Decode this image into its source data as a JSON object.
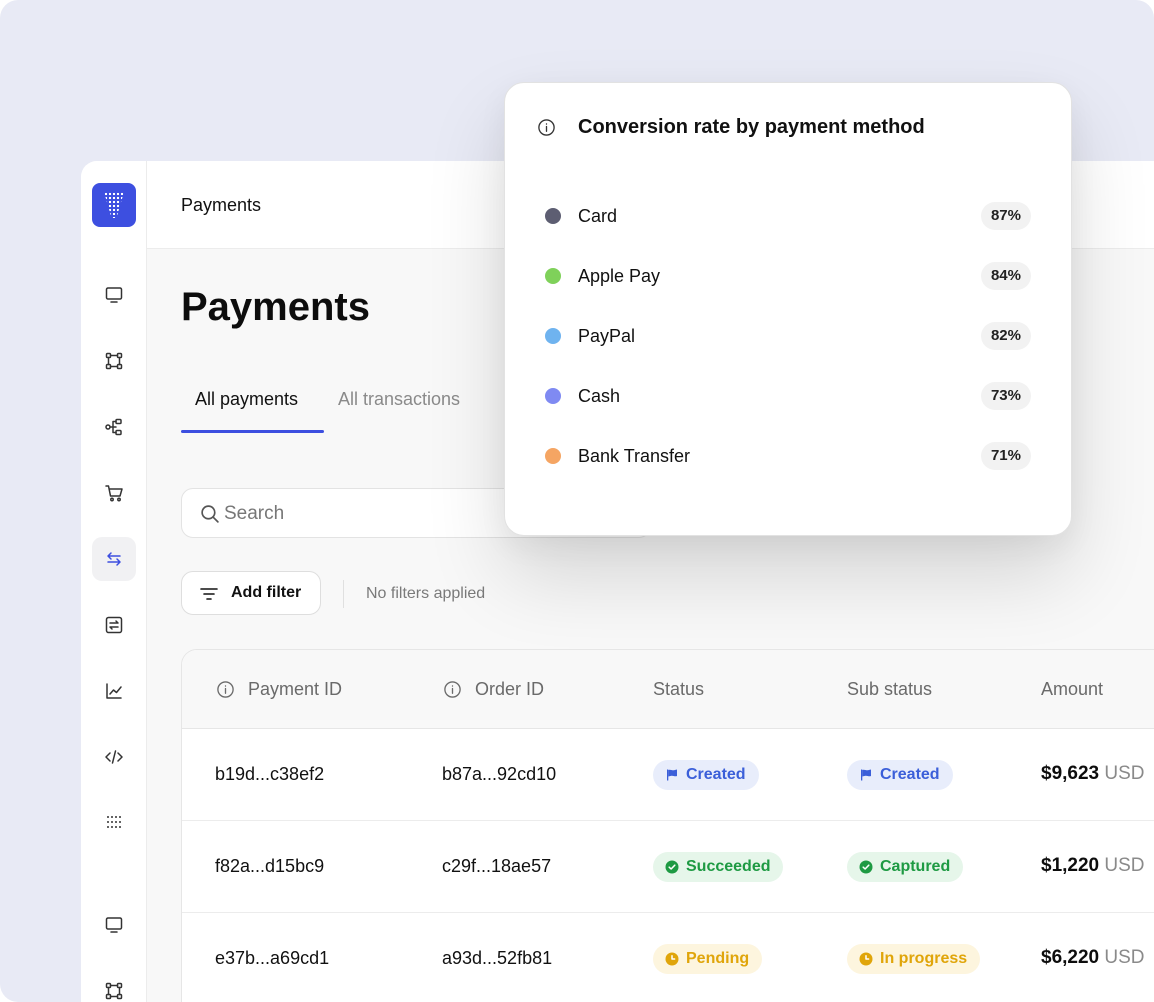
{
  "topbar": {
    "breadcrumb": "Payments"
  },
  "page": {
    "title": "Payments"
  },
  "tabs": [
    {
      "label": "All payments",
      "active": true
    },
    {
      "label": "All transactions",
      "active": false
    }
  ],
  "search": {
    "placeholder": "Search"
  },
  "filters": {
    "add_label": "Add filter",
    "status": "No filters applied"
  },
  "sidebar": {
    "items": [
      {
        "icon": "monitor-icon"
      },
      {
        "icon": "nodes-icon"
      },
      {
        "icon": "workflow-icon"
      },
      {
        "icon": "cart-icon"
      },
      {
        "icon": "transfer-arrows-icon",
        "active": true
      },
      {
        "icon": "exchange-icon"
      },
      {
        "icon": "chart-line-icon"
      },
      {
        "icon": "code-icon"
      },
      {
        "icon": "apps-grid-icon"
      },
      {
        "icon": "monitor-icon"
      },
      {
        "icon": "nodes-icon"
      }
    ]
  },
  "table": {
    "columns": [
      "Payment ID",
      "Order ID",
      "Status",
      "Sub status",
      "Amount"
    ],
    "rows": [
      {
        "payment_id": "b19d...c38ef2",
        "order_id": "b87a...92cd10",
        "status": "Created",
        "status_color": "blue",
        "sub_status": "Created",
        "sub_status_color": "blue",
        "amount": "$9,623",
        "currency": "USD"
      },
      {
        "payment_id": "f82a...d15bc9",
        "order_id": "c29f...18ae57",
        "status": "Succeeded",
        "status_color": "green",
        "sub_status": "Captured",
        "sub_status_color": "green",
        "amount": "$1,220",
        "currency": "USD"
      },
      {
        "payment_id": "e37b...a69cd1",
        "order_id": "a93d...52fb81",
        "status": "Pending",
        "status_color": "yellow",
        "sub_status": "In progress",
        "sub_status_color": "yellow",
        "amount": "$6,220",
        "currency": "USD"
      }
    ]
  },
  "popup": {
    "title": "Conversion rate by payment method",
    "methods": [
      {
        "name": "Card",
        "percent": "87%",
        "color": "#5d5e72"
      },
      {
        "name": "Apple Pay",
        "percent": "84%",
        "color": "#7fd15a"
      },
      {
        "name": "PayPal",
        "percent": "82%",
        "color": "#6fb3ef"
      },
      {
        "name": "Cash",
        "percent": "73%",
        "color": "#7f8af2"
      },
      {
        "name": "Bank Transfer",
        "percent": "71%",
        "color": "#f5a563"
      }
    ]
  },
  "colors": {
    "accent": "#3d4fe0",
    "badge_blue": "#3b5fd9",
    "badge_green": "#1e9a43",
    "badge_yellow": "#e0a50a"
  }
}
